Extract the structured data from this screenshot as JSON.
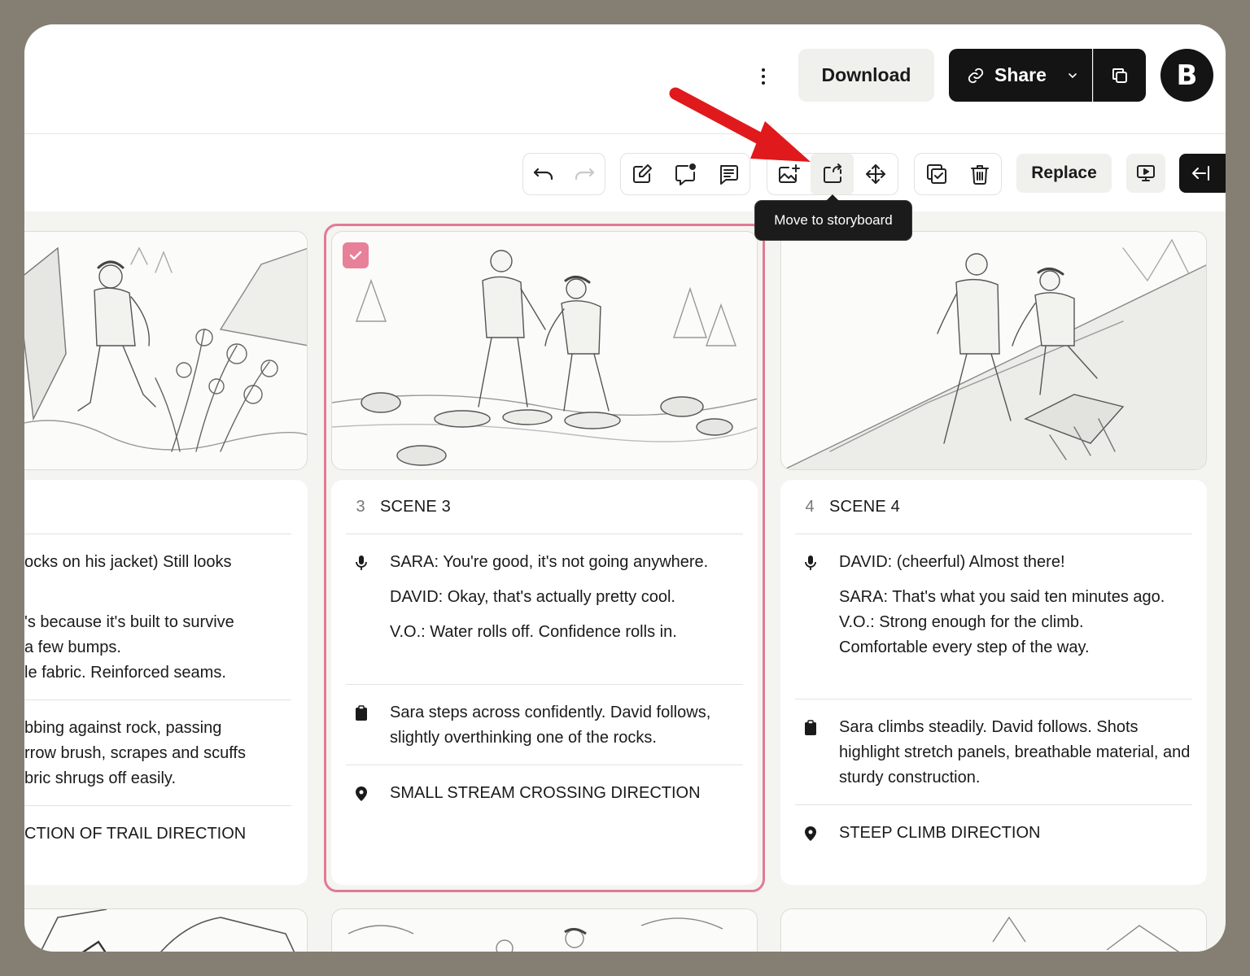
{
  "header": {
    "download_label": "Download",
    "share_label": "Share",
    "avatar_initial": "B"
  },
  "toolbar": {
    "replace_label": "Replace",
    "tooltip": "Move to storyboard"
  },
  "colors": {
    "accent_pink": "#e07a95",
    "dark": "#141414"
  },
  "left_card": {
    "dialogue_lines": [
      "ocks on his jacket) Still looks",
      "'s because it's built to survive",
      "a few bumps.",
      "le fabric. Reinforced seams."
    ],
    "action_lines": [
      "bbing against rock, passing",
      "rrow brush, scrapes and scuffs",
      "bric shrugs off easily."
    ],
    "location": "CTION OF TRAIL DIRECTION"
  },
  "scenes": [
    {
      "number": "3",
      "title": "SCENE 3",
      "dialogue": [
        "SARA: You're good, it's not going anywhere.",
        "DAVID: Okay, that's actually pretty cool.",
        "V.O.: Water rolls off. Confidence rolls in."
      ],
      "action": "Sara steps across confidently. David follows, slightly overthinking one of the rocks.",
      "location": "SMALL STREAM CROSSING DIRECTION"
    },
    {
      "number": "4",
      "title": "SCENE 4",
      "dialogue_first": "DAVID: (cheerful) Almost there!",
      "dialogue_rest": [
        "SARA: That's what you said ten minutes ago.",
        "V.O.: Strong enough for the climb.",
        "Comfortable every step of the way."
      ],
      "action": "Sara climbs steadily. David follows. Shots highlight stretch panels, breathable material, and sturdy construction.",
      "location": "STEEP CLIMB DIRECTION"
    }
  ]
}
